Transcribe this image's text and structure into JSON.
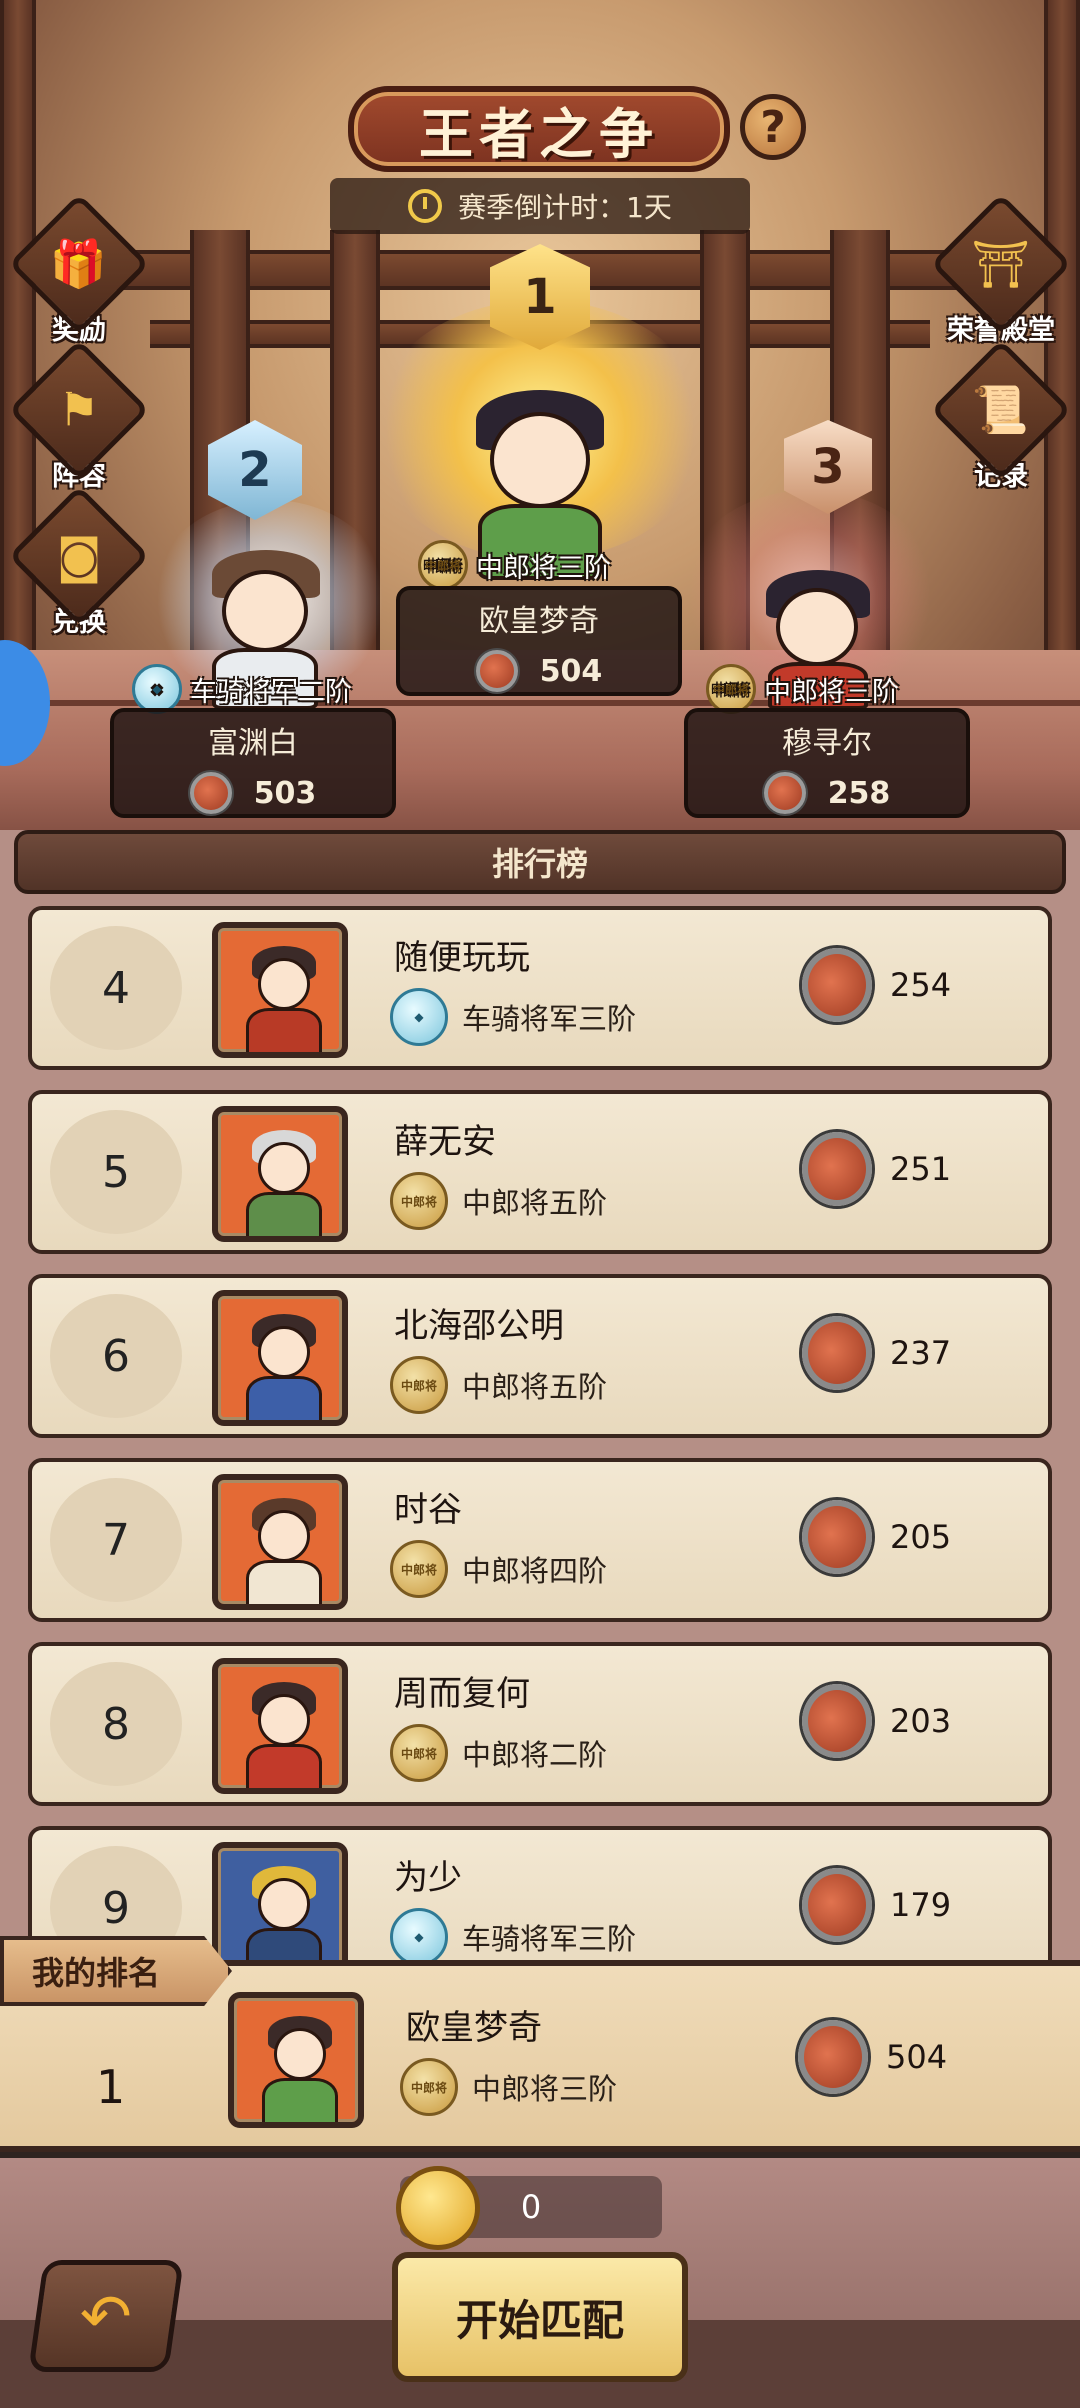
{
  "header": {
    "title": "王者之争",
    "help": "?",
    "countdown": "赛季倒计时：1天"
  },
  "side_menu": {
    "left": [
      {
        "label": "奖励",
        "icon": "gift-icon"
      },
      {
        "label": "阵容",
        "icon": "flag-icon"
      },
      {
        "label": "兑换",
        "icon": "coin-exchange-icon"
      }
    ],
    "right": [
      {
        "label": "荣誉殿堂",
        "icon": "temple-icon"
      },
      {
        "label": "记录",
        "icon": "scroll-icon"
      }
    ]
  },
  "podium": {
    "first": {
      "rank": "1",
      "name": "欧皇梦奇",
      "title": "中郎将三阶",
      "score": "504"
    },
    "second": {
      "rank": "2",
      "name": "富渊白",
      "title": "车骑将军二阶",
      "score": "503"
    },
    "third": {
      "rank": "3",
      "name": "穆寻尔",
      "title": "中郎将三阶",
      "score": "258"
    }
  },
  "board": {
    "title": "排行榜",
    "rows": [
      {
        "rank": "4",
        "name": "随便玩玩",
        "title": "车骑将军三阶",
        "emblem": "blue",
        "score": "254"
      },
      {
        "rank": "5",
        "name": "薛无安",
        "title": "中郎将五阶",
        "emblem": "gold",
        "score": "251"
      },
      {
        "rank": "6",
        "name": "北海邵公明",
        "title": "中郎将五阶",
        "emblem": "gold",
        "score": "237"
      },
      {
        "rank": "7",
        "name": "时谷",
        "title": "中郎将四阶",
        "emblem": "gold",
        "score": "205"
      },
      {
        "rank": "8",
        "name": "周而复何",
        "title": "中郎将二阶",
        "emblem": "gold",
        "score": "203"
      },
      {
        "rank": "9",
        "name": "为少",
        "title": "车骑将军三阶",
        "emblem": "blue",
        "score": "179"
      }
    ]
  },
  "my_rank": {
    "tab_label": "我的排名",
    "rank": "1",
    "name": "欧皇梦奇",
    "title": "中郎将三阶",
    "score": "504"
  },
  "bottom": {
    "coins": "0",
    "start_label": "开始匹配"
  },
  "emblem_text": "中郎将",
  "colors": {
    "title_plate": "#a24a2e",
    "row_bg": "#f3e8d3",
    "start_button": "#e7c267",
    "board_bg": "#b58f86"
  }
}
